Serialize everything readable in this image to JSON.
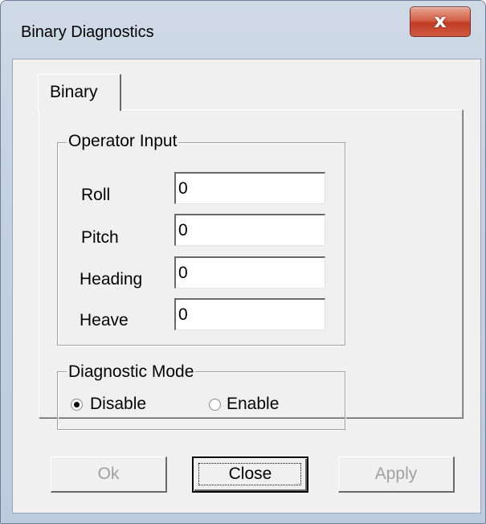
{
  "window": {
    "title": "Binary Diagnostics",
    "close_glyph": "x"
  },
  "tabs": [
    {
      "label": "Binary",
      "active": true
    }
  ],
  "operator_input": {
    "legend": "Operator Input",
    "fields": [
      {
        "label": "Roll",
        "value": "0"
      },
      {
        "label": "Pitch",
        "value": "0"
      },
      {
        "label": "Heading",
        "value": "0"
      },
      {
        "label": "Heave",
        "value": "0"
      }
    ]
  },
  "diagnostic_mode": {
    "legend": "Diagnostic Mode",
    "options": [
      {
        "label": "Disable",
        "selected": true
      },
      {
        "label": "Enable",
        "selected": false
      }
    ]
  },
  "buttons": {
    "ok": "Ok",
    "close": "Close",
    "apply": "Apply"
  },
  "colors": {
    "titlebar": "#c4d1e2",
    "close_button": "#c23b23",
    "dialog_face": "#f0f0f0"
  }
}
